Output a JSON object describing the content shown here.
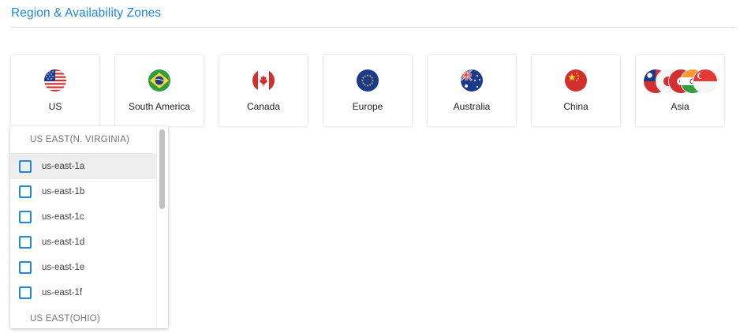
{
  "section": {
    "title": "Region & Availability Zones"
  },
  "regions": [
    {
      "label": "US",
      "icon": "us-flag-icon"
    },
    {
      "label": "South America",
      "icon": "brazil-flag-icon"
    },
    {
      "label": "Canada",
      "icon": "canada-flag-icon"
    },
    {
      "label": "Europe",
      "icon": "eu-flag-icon"
    },
    {
      "label": "Australia",
      "icon": "australia-flag-icon"
    },
    {
      "label": "China",
      "icon": "china-flag-icon"
    },
    {
      "label": "Asia",
      "icon": "asia-flags-icon"
    }
  ],
  "dropdown": {
    "groups": [
      {
        "header": "US EAST(N. VIRGINIA)",
        "options": [
          {
            "label": "us-east-1a",
            "checked": false
          },
          {
            "label": "us-east-1b",
            "checked": false
          },
          {
            "label": "us-east-1c",
            "checked": false
          },
          {
            "label": "us-east-1d",
            "checked": false
          },
          {
            "label": "us-east-1e",
            "checked": false
          },
          {
            "label": "us-east-1f",
            "checked": false
          }
        ]
      },
      {
        "header": "US EAST(OHIO)",
        "options": []
      }
    ]
  },
  "colors": {
    "accent": "#1e88e5",
    "title": "#1e88e5",
    "hover": "#eeeeee"
  }
}
